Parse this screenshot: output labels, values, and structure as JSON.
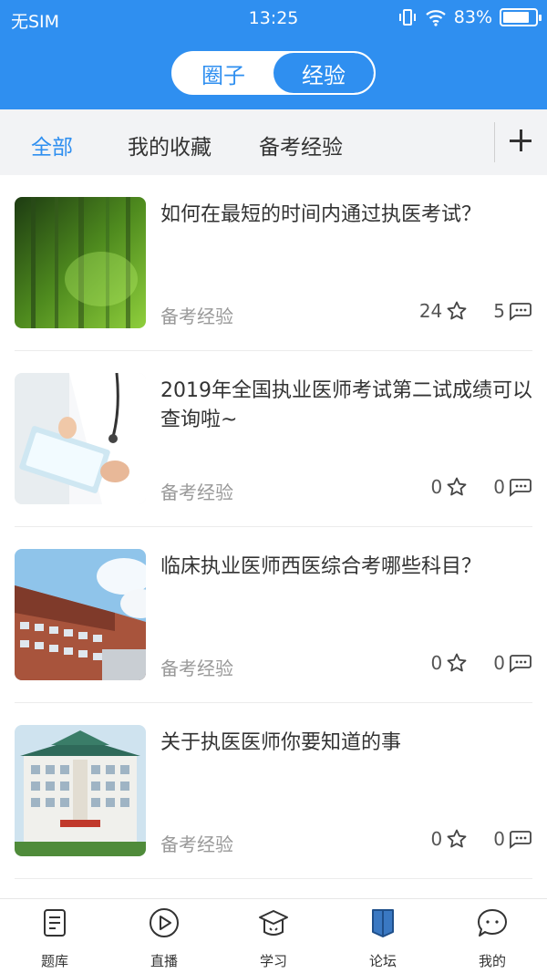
{
  "status": {
    "carrier": "无SIM",
    "time": "13:25",
    "battery": "83%",
    "battery_level": 0.83
  },
  "segment": {
    "options": [
      "圈子",
      "经验"
    ],
    "selected": "经验"
  },
  "tabs": {
    "items": [
      "全部",
      "我的收藏",
      "备考经验"
    ],
    "active": "全部"
  },
  "articles": [
    {
      "title": "如何在最短的时间内通过执医考试？",
      "tag": "备考经验",
      "favorites": "24",
      "comments": "5"
    },
    {
      "title": "2019年全国执业医师考试第二试成绩可以查询啦~",
      "tag": "备考经验",
      "favorites": "0",
      "comments": "0"
    },
    {
      "title": "临床执业医师西医综合考哪些科目？",
      "tag": "备考经验",
      "favorites": "0",
      "comments": "0"
    },
    {
      "title": "关于执医医师你要知道的事",
      "tag": "备考经验",
      "favorites": "0",
      "comments": "0"
    }
  ],
  "tabbar": {
    "items": [
      {
        "label": "题库",
        "icon": "document-icon"
      },
      {
        "label": "直播",
        "icon": "play-icon"
      },
      {
        "label": "学习",
        "icon": "graduation-cap-icon"
      },
      {
        "label": "论坛",
        "icon": "bookmark-icon"
      },
      {
        "label": "我的",
        "icon": "chat-bubble-icon"
      }
    ],
    "active": "论坛"
  },
  "colors": {
    "primary": "#2f8ff0",
    "tab_bg": "#f2f3f5",
    "muted": "#999999"
  }
}
